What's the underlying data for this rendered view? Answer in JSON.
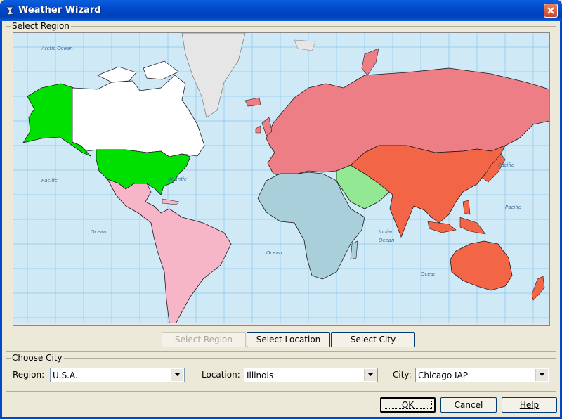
{
  "window": {
    "title": "Weather Wizard"
  },
  "select_region": {
    "group_title": "Select Region",
    "map": {
      "ocean_labels": [
        "Arctic Ocean",
        "Pacific",
        "Atlantic",
        "Pacific",
        "Ocean",
        "Ocean",
        "Indian",
        "Ocean",
        "Pacific",
        "Ocean"
      ],
      "colors": {
        "ocean": "#cfe9f7",
        "grid": "#8fc5ea",
        "usa": "#00e000",
        "canada": "#ffffff",
        "latin_america": "#f7b6c7",
        "europe_russia": "#ee7e86",
        "asia_oceania": "#f26547",
        "africa": "#a9cfdb",
        "middle_east": "#93e893",
        "ice": "#e6e6e6"
      }
    },
    "buttons": {
      "select_region": "Select Region",
      "select_location": "Select Location",
      "select_city": "Select City"
    }
  },
  "choose_city": {
    "group_title": "Choose City",
    "region_label": "Region:",
    "region_value": "U.S.A.",
    "location_label": "Location:",
    "location_value": "Illinois",
    "city_label": "City:",
    "city_value": "Chicago IAP"
  },
  "footer": {
    "ok": "OK",
    "cancel": "Cancel",
    "help": "Help"
  }
}
